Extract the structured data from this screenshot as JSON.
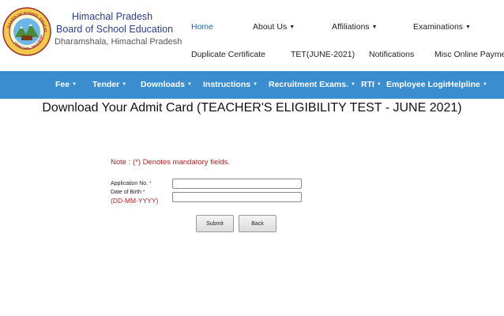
{
  "header": {
    "title_line1": "Himachal Pradesh",
    "title_line2": "Board of School Education",
    "subtitle": "Dharamshala, Himachal Pradesh"
  },
  "top_nav": [
    {
      "label": "Home"
    },
    {
      "label": "About Us"
    },
    {
      "label": "Affiliations"
    },
    {
      "label": "Examinations"
    },
    {
      "label": "Duplicate Certificate"
    },
    {
      "label": "TET(JUNE-2021)"
    },
    {
      "label": "Notifications"
    },
    {
      "label": "Misc Online Payment"
    }
  ],
  "main_nav": [
    {
      "label": "Fee"
    },
    {
      "label": "Tender"
    },
    {
      "label": "Downloads"
    },
    {
      "label": "Instructions"
    },
    {
      "label": "Recruitment Exams."
    },
    {
      "label": "RTI"
    },
    {
      "label": "Employee Login"
    },
    {
      "label": "Helpline"
    }
  ],
  "page": {
    "heading": "Download Your Admit Card (TEACHER'S ELIGIBILITY TEST - JUNE 2021)",
    "note": "Note  : (*) Denotes mandatory fields."
  },
  "form": {
    "application_label": "Application No.",
    "dob_label": "Date of Birth",
    "required_mark": "*",
    "dob_hint": "(DD-MM-YYYY)",
    "application_value": "",
    "dob_value": "",
    "submit_label": "Submit",
    "back_label": "Back"
  },
  "colors": {
    "nav_bar": "#3a8ed0",
    "brand_text": "#2d3f8a",
    "note_text": "#b22222"
  },
  "icons": {
    "logo": "hpbose-emblem",
    "dropdown": "caret-down-icon"
  }
}
